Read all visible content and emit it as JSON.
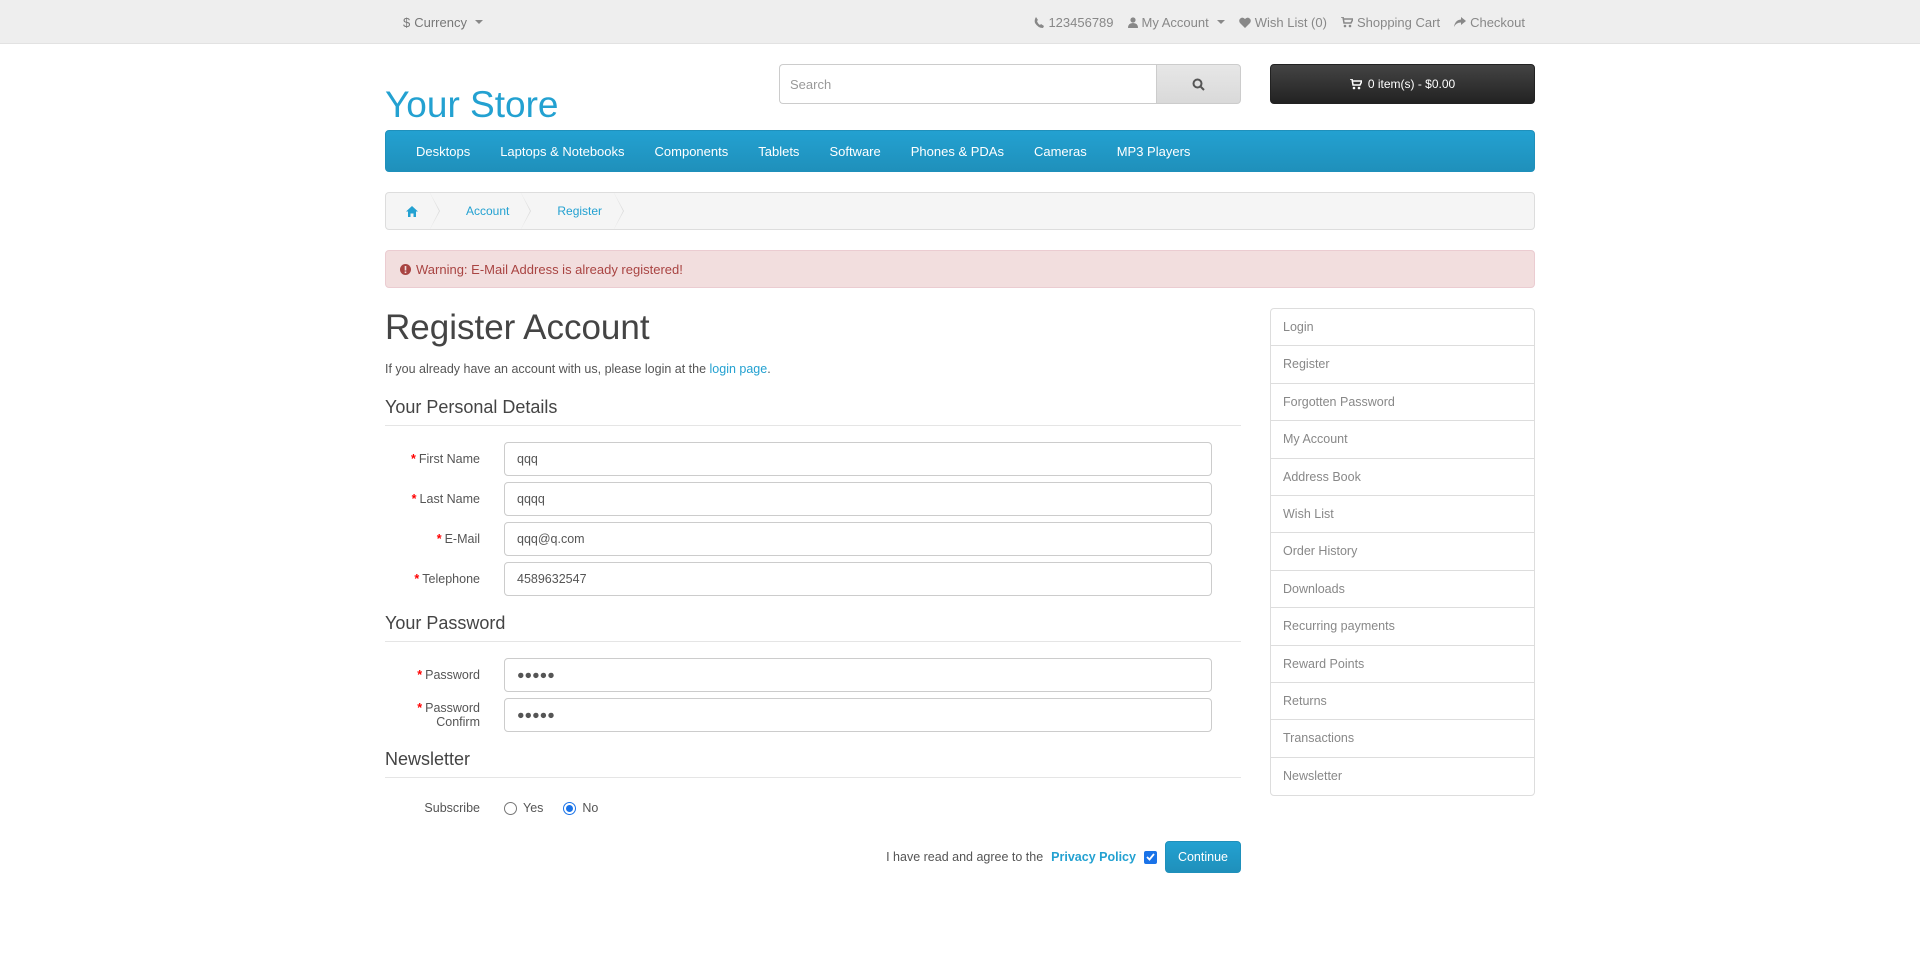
{
  "topbar": {
    "currency_symbol": "$",
    "currency_label": "Currency",
    "phone": "123456789",
    "my_account": "My Account",
    "wish_list": "Wish List (0)",
    "shopping_cart": "Shopping Cart",
    "checkout": "Checkout"
  },
  "header": {
    "logo": "Your Store",
    "search_placeholder": "Search",
    "cart_label": "0 item(s) - $0.00"
  },
  "menu": [
    "Desktops",
    "Laptops & Notebooks",
    "Components",
    "Tablets",
    "Software",
    "Phones & PDAs",
    "Cameras",
    "MP3 Players"
  ],
  "breadcrumb": [
    "Account",
    "Register"
  ],
  "alert": "Warning: E-Mail Address is already registered!",
  "page": {
    "title": "Register Account",
    "intro_text": "If you already have an account with us, please login at the ",
    "intro_link": "login page",
    "intro_end": "."
  },
  "personal": {
    "legend": "Your Personal Details",
    "firstname_label": "First Name",
    "firstname_value": "qqq",
    "lastname_label": "Last Name",
    "lastname_value": "qqqq",
    "email_label": "E-Mail",
    "email_value": "qqq@q.com",
    "telephone_label": "Telephone",
    "telephone_value": "4589632547"
  },
  "password": {
    "legend": "Your Password",
    "password_label": "Password",
    "password_value": "●●●●●",
    "confirm_label": "Password Confirm",
    "confirm_value": "●●●●●"
  },
  "newsletter": {
    "legend": "Newsletter",
    "subscribe_label": "Subscribe",
    "yes": "Yes",
    "no": "No",
    "selected": "No"
  },
  "agree": {
    "text": "I have read and agree to the",
    "link": "Privacy Policy",
    "checked": true,
    "continue": "Continue"
  },
  "sidebar": [
    "Login",
    "Register",
    "Forgotten Password",
    "My Account",
    "Address Book",
    "Wish List",
    "Order History",
    "Downloads",
    "Recurring payments",
    "Reward Points",
    "Returns",
    "Transactions",
    "Newsletter"
  ],
  "colors": {
    "accent": "#23a1d1",
    "alert_bg": "#f2dede",
    "alert_text": "#a94442",
    "cart_bg": "#333333"
  }
}
